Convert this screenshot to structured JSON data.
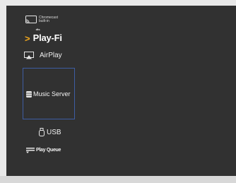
{
  "sidebar": {
    "items": [
      {
        "id": "chromecast",
        "line1": "Chromecast",
        "line2": "built-in",
        "icon": "cast-icon"
      },
      {
        "id": "playfi",
        "brand": "dts",
        "label": "Play-Fi",
        "icon": "chevron-right-icon",
        "accent": "#f2a81d"
      },
      {
        "id": "airplay",
        "label": "AirPlay",
        "icon": "airplay-icon"
      },
      {
        "id": "music_server",
        "label": "Music Server",
        "icon": "database-icon",
        "selected": true,
        "highlight": "#3e5da3"
      },
      {
        "id": "usb",
        "label": "USB",
        "icon": "usb-icon"
      },
      {
        "id": "play_queue",
        "label": "Play Queue",
        "icon": "queue-list-icon"
      }
    ]
  },
  "colors": {
    "background": "#313131",
    "frame": "#e9e9e9"
  }
}
